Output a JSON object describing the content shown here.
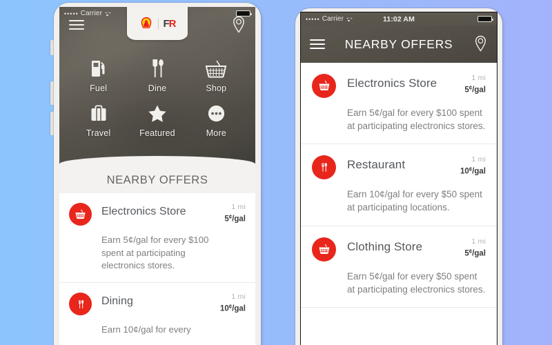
{
  "background": {
    "from": "#8cc5fd",
    "to": "#a3b3fb"
  },
  "accent_red": "#e8261c",
  "status_bar": {
    "carrier": "Carrier",
    "signal_dots": "•••••",
    "time": "11:02 AM",
    "wifi_icon": "wifi-icon",
    "battery_icon": "battery-icon"
  },
  "left_phone": {
    "menu_icon": "hamburger-menu-icon",
    "location_icon": "location-pin-icon",
    "brand": {
      "primary_logo": "shell-logo",
      "secondary_logo": "fr-logo",
      "secondary_text_f": "F",
      "secondary_text_r": "R"
    },
    "categories": [
      {
        "label": "Fuel",
        "icon": "fuel-pump-icon"
      },
      {
        "label": "Dine",
        "icon": "fork-spoon-icon"
      },
      {
        "label": "Shop",
        "icon": "shopping-basket-icon"
      },
      {
        "label": "Travel",
        "icon": "suitcase-icon"
      },
      {
        "label": "Featured",
        "icon": "star-icon"
      },
      {
        "label": "More",
        "icon": "ellipsis-circle-icon"
      }
    ],
    "section_title": "NEARBY OFFERS",
    "offers": [
      {
        "name": "Electronics Store",
        "icon": "shopping-basket-icon",
        "distance": "1 mi",
        "rate_value": "5",
        "rate_unit": "¢",
        "rate_suffix": "/gal",
        "description": "Earn 5¢/gal for every $100 spent at participating electronics stores."
      },
      {
        "name": "Dining",
        "icon": "fork-spoon-icon",
        "distance": "1 mi",
        "rate_value": "10",
        "rate_unit": "¢",
        "rate_suffix": "/gal",
        "description": "Earn 10¢/gal for every"
      }
    ]
  },
  "right_phone": {
    "menu_icon": "hamburger-menu-icon",
    "location_icon": "location-pin-icon",
    "title": "NEARBY OFFERS",
    "offers": [
      {
        "name": "Electronics Store",
        "icon": "shopping-basket-icon",
        "distance": "1 mi",
        "rate_value": "5",
        "rate_unit": "¢",
        "rate_suffix": "/gal",
        "description": "Earn 5¢/gal for every $100 spent at participating electronics stores."
      },
      {
        "name": "Restaurant",
        "icon": "fork-spoon-icon",
        "distance": "1 mi",
        "rate_value": "10",
        "rate_unit": "¢",
        "rate_suffix": "/gal",
        "description": "Earn 10¢/gal for every $50 spent at participating locations."
      },
      {
        "name": "Clothing Store",
        "icon": "shopping-basket-icon",
        "distance": "1 mi",
        "rate_value": "5",
        "rate_unit": "¢",
        "rate_suffix": "/gal",
        "description": "Earn 5¢/gal for every $50 spent at participating electronics stores."
      }
    ]
  }
}
